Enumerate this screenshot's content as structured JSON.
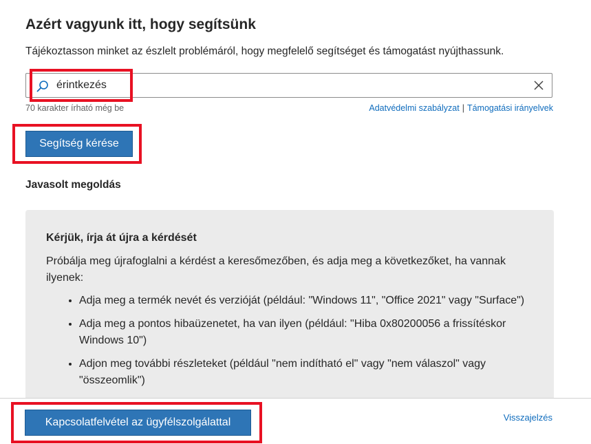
{
  "header": {
    "title": "Azért vagyunk itt, hogy segítsünk",
    "subtitle": "Tájékoztasson minket az észlelt problémáról, hogy megfelelő segítséget és támogatást nyújthassunk."
  },
  "search": {
    "value": "érintkezés",
    "char_count_text": "70 karakter írható még be"
  },
  "links": {
    "privacy": "Adatvédelmi szabályzat",
    "separator": "|",
    "support_guidelines": "Támogatási irányelvek"
  },
  "help_button": {
    "label": "Segítség kérése"
  },
  "suggested": {
    "heading": "Javasolt megoldás",
    "card_title": "Kérjük, írja át újra a kérdését",
    "intro": "Próbálja meg újrafoglalni a kérdést a keresőmezőben, és adja meg a következőket, ha vannak ilyenek:",
    "items": [
      "Adja meg a termék nevét és verzióját (például: \"Windows 11\", \"Office 2021\" vagy \"Surface\")",
      "Adja meg a pontos hibaüzenetet, ha van ilyen (például: \"Hiba 0x80200056 a frissítéskor Windows 10\")",
      "Adjon meg további részleteket (például \"nem indítható el\" vagy \"nem válaszol\" vagy \"összeomlik\")"
    ]
  },
  "footer": {
    "contact_label": "Kapcsolatfelvétel az ügyfélszolgálattal",
    "feedback_label": "Visszajelzés"
  },
  "colors": {
    "primary": "#2e75b6",
    "link": "#0f6cbd",
    "highlight": "#e81123",
    "card_bg": "#ebebeb"
  },
  "icons": {
    "search": "search-icon",
    "clear": "close-icon"
  }
}
